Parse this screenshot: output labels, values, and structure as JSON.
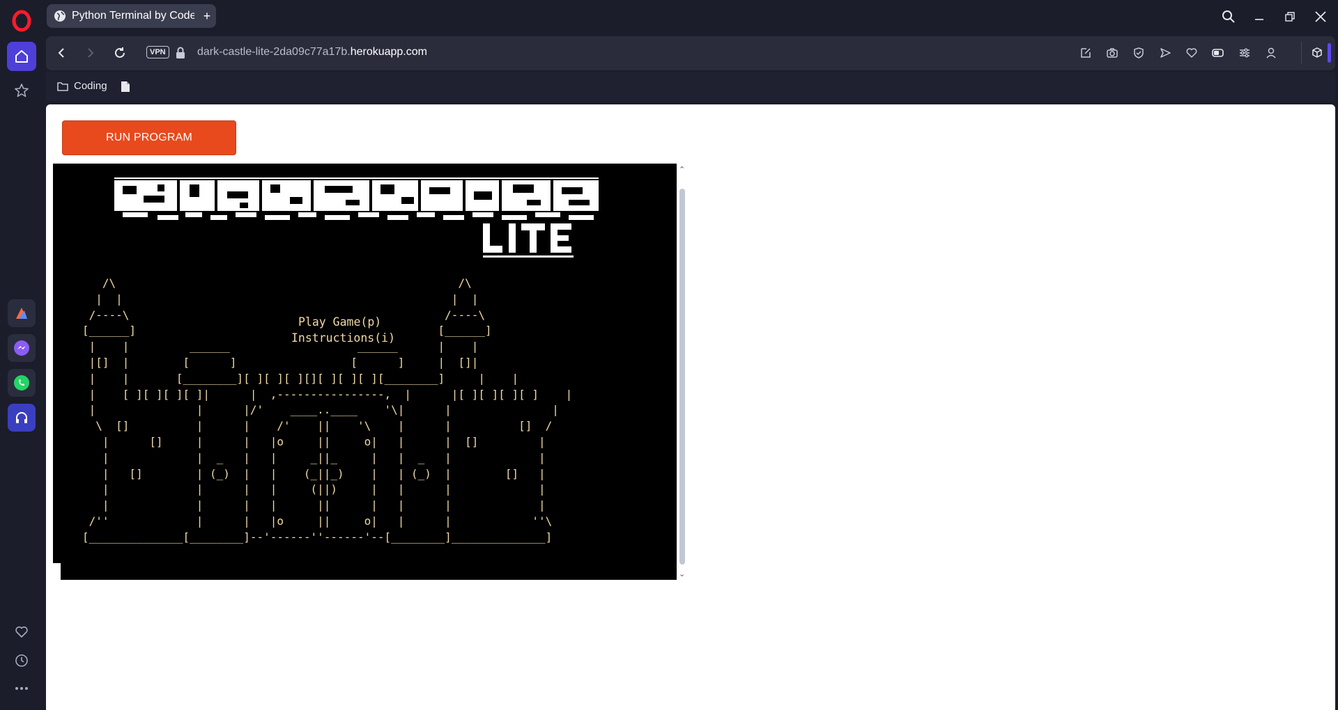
{
  "browser": {
    "tab_title": "Python Terminal by Code Institute",
    "url_host_prefix": "dark-castle-lite-2da09c77a17b.",
    "url_host_domain": "herokuapp.com",
    "vpn_label": "VPN"
  },
  "bookmarks": {
    "folder_label": "Coding"
  },
  "page": {
    "run_button_label": "RUN PROGRAM"
  },
  "terminal": {
    "title_text": "DARK CASTLE",
    "subtitle_text": "LITE",
    "menu_play": "Play Game(p)",
    "menu_instructions": "Instructions(i)",
    "castle_art": "   /\\                                                   /\\\n  |  |                                                 |  |\n /----\\                                               /----\\\n[______]                                             [______]\n |    |         ______                   ______      |    |\n |[]  |        [      ]                 [      ]     |  []|\n |    |       [________][ ][ ][ ][][ ][ ][ ][________]     |    |\n |    [ ][ ][ ][ ]|      |  ,----------------,  |      |[ ][ ][ ][ ]    |\n |               |      |/'    ____..____    '\\|      |               |\n  \\  []          |      |    /'    ||    '\\    |      |          []  /\n   |      []     |      |   |o     ||     o|   |      |  []         |\n   |             |  _   |   |     _||_     |   |  _   |             |\n   |   []        | (_)  |   |    (_||_)    |   | (_)  |        []   |\n   |             |      |   |     (||)     |   |      |             |\n   |             |      |   |      ||      |   |      |             |\n /''             |      |   |o     ||     o|   |      |            ''\\\n[______________[________]--'------''------'--[________]______________]"
  },
  "colors": {
    "accent": "#e84a1e",
    "terminal_bg": "#000000",
    "terminal_text": "#f0d9a5",
    "sidebar_active": "#4f3fd9"
  }
}
